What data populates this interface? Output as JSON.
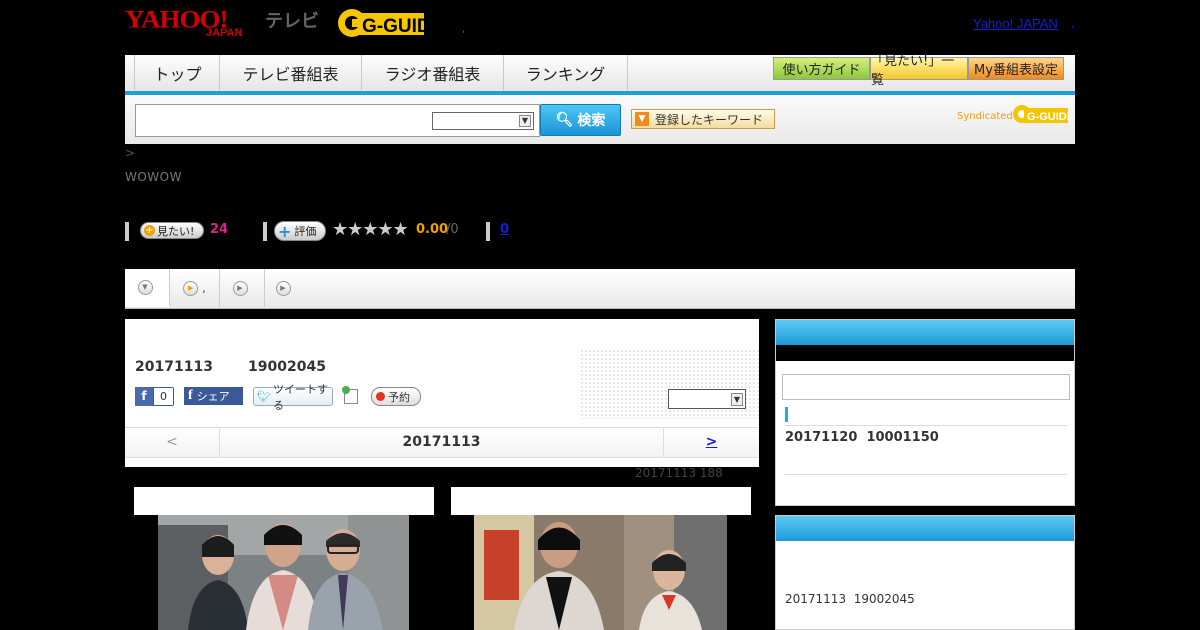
{
  "header": {
    "yahoo_logo": "YAHOO!",
    "yahoo_sub": "JAPAN",
    "tv_label": "テレビ",
    "gguide_logo": "G-GUIDE",
    "dot": ",",
    "yahoo_japan_link": "Yahoo! JAPAN",
    "link_sep": ","
  },
  "nav": {
    "tabs": [
      "トップ",
      "テレビ番組表",
      "ラジオ番組表",
      "ランキング"
    ],
    "buttons": [
      "使い方ガイド",
      "「見たい!」一覧",
      "My番組表設定"
    ]
  },
  "search": {
    "button_label": "検索",
    "keyword_button": "登録したキーワード",
    "syndicated": "Syndicated"
  },
  "breadcrumb": ">",
  "channel": "WOWOW",
  "stats": {
    "mitai_label": "見たい!",
    "mitai_count": "24",
    "hyoka_label": "評価",
    "stars": "★★★★★",
    "rating": "0.00",
    "rating_max": "/0",
    "comment_count": "0"
  },
  "tabs": [
    {
      "label": ""
    },
    {
      "label": ","
    },
    {
      "label": ""
    },
    {
      "label": ""
    }
  ],
  "program": {
    "date": "20171113",
    "id": "19002045",
    "fb_like_count": "0",
    "fb_share_label": "シェア",
    "tweet_label": "ツイートする",
    "yoyaku_label": "予約",
    "nav_prev": "<",
    "nav_date": "20171113",
    "nav_next": ">"
  },
  "caption_note": "20171113  188",
  "sidebar": {
    "item_date": "20171120",
    "item_id": "10001150",
    "bottom_date": "20171113",
    "bottom_id": "19002045"
  },
  "colors": {
    "accent_blue": "#1e9fd8",
    "yahoo_red": "#d40000",
    "gguide_yellow": "#f5c500",
    "mitai_pink": "#e0208a",
    "rating_orange": "#f0a000"
  }
}
